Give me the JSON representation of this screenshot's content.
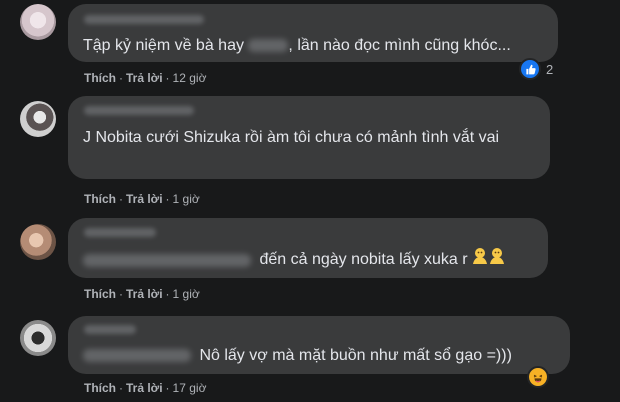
{
  "comments": [
    {
      "text": "Tập kỷ niệm về bà hay",
      "text_after": ", lần nào đọc mình cũng khóc...",
      "like_label": "Thích",
      "reply_label": "Trả lời",
      "time": "12 giờ",
      "reaction_count": "2",
      "reaction_icon": "like-icon"
    },
    {
      "text": "J Nobita cưới Shizuka rồi àm tôi chưa có mảnh tình vắt vai",
      "like_label": "Thích",
      "reply_label": "Trả lời",
      "time": "1 giờ"
    },
    {
      "text": "đến cả ngày nobita lấy xuka r",
      "like_label": "Thích",
      "reply_label": "Trả lời",
      "time": "1 giờ",
      "emoji_icon": "pleading-hands-icon"
    },
    {
      "text": "Nô lấy vợ mà mặt buồn như mất sổ gạo =)))",
      "like_label": "Thích",
      "reply_label": "Trả lời",
      "time": "17 giờ",
      "reaction_icon": "haha-icon"
    }
  ],
  "colors": {
    "background": "#18191a",
    "bubble": "#3a3b3c",
    "text": "#e4e6eb",
    "meta": "#b0b3b8",
    "like_blue": "#1877f2",
    "haha_yellow": "#f7b125"
  }
}
